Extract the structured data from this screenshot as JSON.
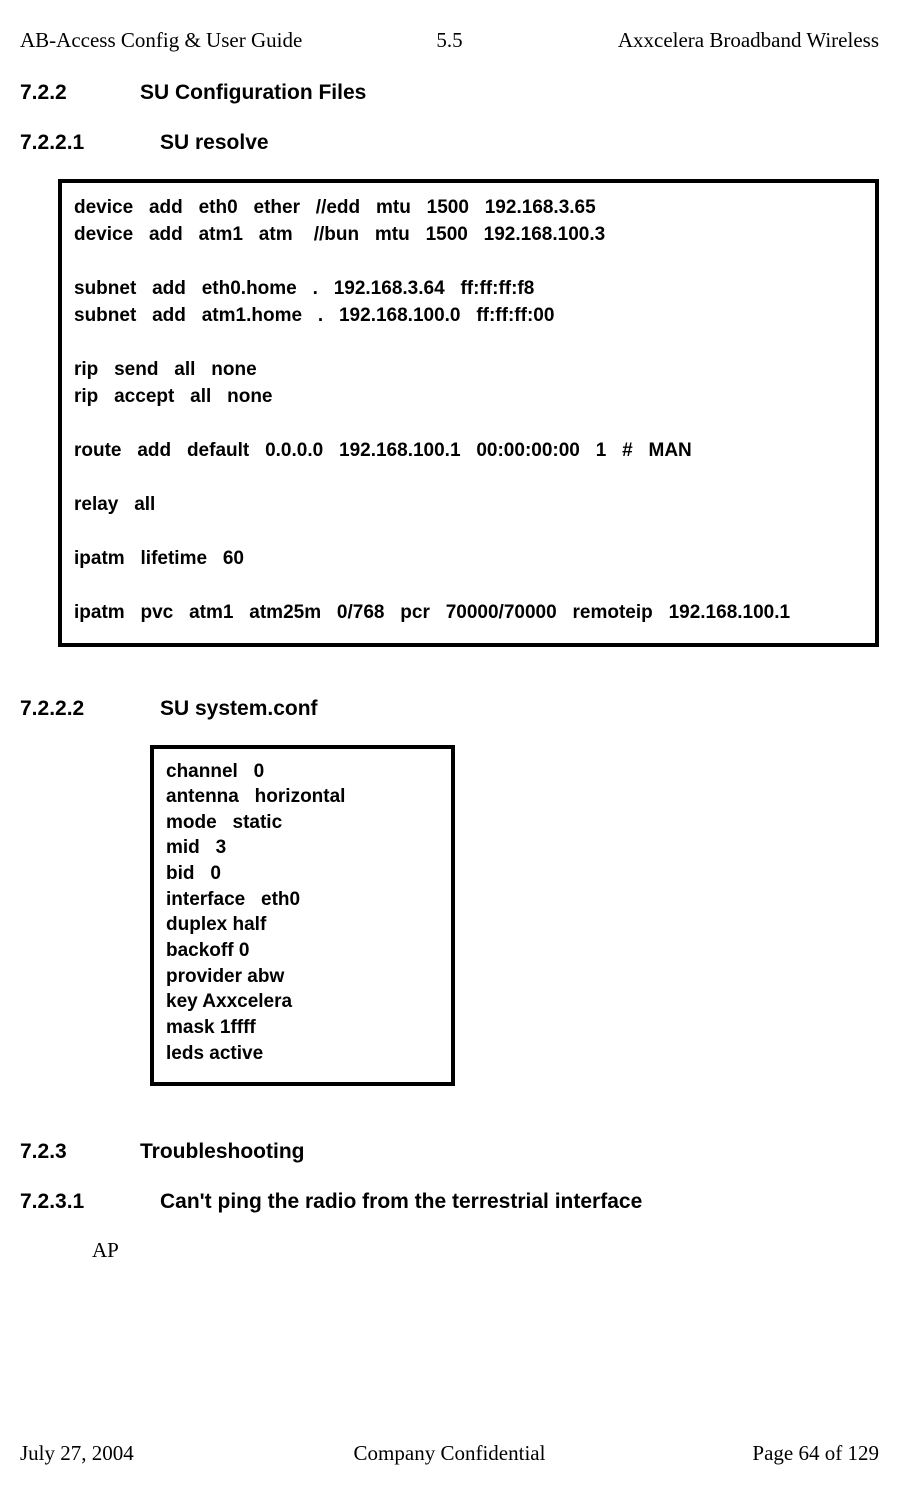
{
  "header": {
    "left": "AB-Access Config & User Guide",
    "center": "5.5",
    "right": "Axxcelera Broadband Wireless"
  },
  "sections": {
    "s722": {
      "num": "7.2.2",
      "title": "SU Configuration Files"
    },
    "s7221": {
      "num": "7.2.2.1",
      "title": "SU resolve"
    },
    "s7222": {
      "num": "7.2.2.2",
      "title": "SU system.conf"
    },
    "s723": {
      "num": "7.2.3",
      "title": "Troubleshooting"
    },
    "s7231": {
      "num": "7.2.3.1",
      "title": "Can't ping the radio from the terrestrial interface"
    }
  },
  "code": {
    "resolve": "device   add   eth0   ether   //edd   mtu   1500   192.168.3.65\ndevice   add   atm1   atm    //bun   mtu   1500   192.168.100.3\n\nsubnet   add   eth0.home   .   192.168.3.64   ff:ff:ff:f8\nsubnet   add   atm1.home   .   192.168.100.0   ff:ff:ff:00\n\nrip   send   all   none\nrip   accept   all   none\n\nroute   add   default   0.0.0.0   192.168.100.1   00:00:00:00   1   #   MAN\n\nrelay   all\n\nipatm   lifetime   60\n\nipatm   pvc   atm1   atm25m   0/768   pcr   70000/70000   remoteip   192.168.100.1",
    "systemconf": "channel   0\nantenna   horizontal\nmode   static\nmid   3\nbid   0\ninterface   eth0\nduplex half\nbackoff 0\nprovider abw\nkey Axxcelera\nmask 1ffff\nleds active"
  },
  "body": {
    "ap": "AP"
  },
  "footer": {
    "left": "July 27, 2004",
    "center": "Company Confidential",
    "right": "Page 64 of 129"
  }
}
